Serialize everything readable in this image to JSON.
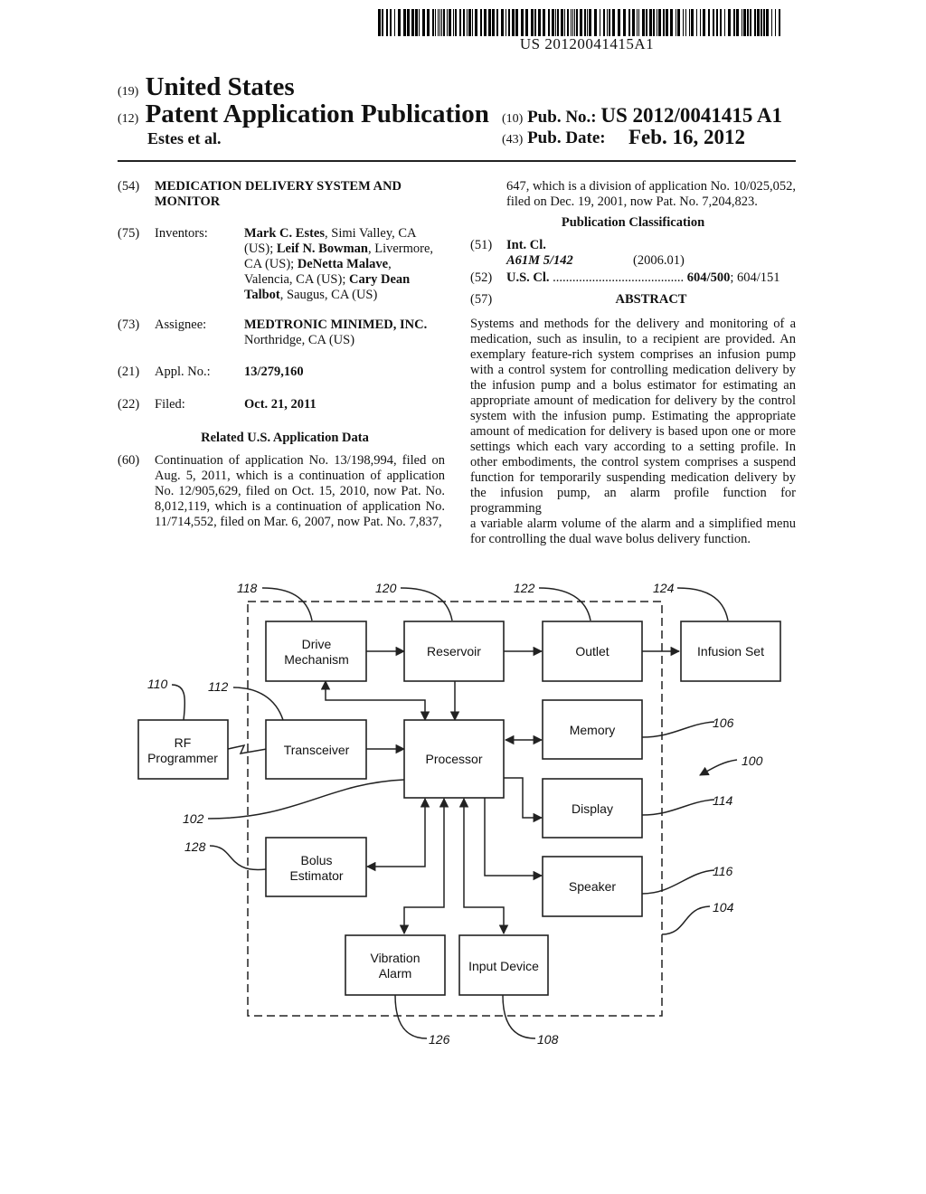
{
  "barcode": {
    "number": "US 20120041415A1"
  },
  "header": {
    "country_code": "(19)",
    "country": "United States",
    "type_code": "(12)",
    "type": "Patent Application Publication",
    "authors": "Estes et al.",
    "pub_no_code": "(10)",
    "pub_no_label": "Pub. No.:",
    "pub_no": "US 2012/0041415 A1",
    "pub_date_code": "(43)",
    "pub_date_label": "Pub. Date:",
    "pub_date": "Feb. 16, 2012"
  },
  "left": {
    "title": {
      "code": "(54)",
      "line1": "MEDICATION DELIVERY SYSTEM AND",
      "line2": "MONITOR"
    },
    "inventors": {
      "code": "(75)",
      "label": "Inventors:",
      "lines": [
        [
          {
            "t": "Mark C. Estes",
            "b": true
          },
          {
            "t": ", Simi Valley, CA",
            "b": false
          }
        ],
        [
          {
            "t": "(US); ",
            "b": false
          },
          {
            "t": "Leif N. Bowman",
            "b": true
          },
          {
            "t": ", Livermore,",
            "b": false
          }
        ],
        [
          {
            "t": "CA (US); ",
            "b": false
          },
          {
            "t": "DeNetta Malave",
            "b": true
          },
          {
            "t": ",",
            "b": false
          }
        ],
        [
          {
            "t": "Valencia, CA (US); ",
            "b": false
          },
          {
            "t": "Cary Dean",
            "b": true
          }
        ],
        [
          {
            "t": "Talbot",
            "b": true
          },
          {
            "t": ", Saugus, CA (US)",
            "b": false
          }
        ]
      ]
    },
    "assignee": {
      "code": "(73)",
      "label": "Assignee:",
      "name": "MEDTRONIC MINIMED, INC.",
      "location": "Northridge, CA (US)"
    },
    "appl": {
      "code": "(21)",
      "label": "Appl. No.:",
      "value": "13/279,160"
    },
    "filed": {
      "code": "(22)",
      "label": "Filed:",
      "value": "Oct. 21, 2011"
    },
    "related_heading": "Related U.S. Application Data",
    "related": {
      "code": "(60)",
      "lines": [
        "Continuation of application No. 13/198,994, filed on",
        "Aug. 5, 2011, which is a continuation of application",
        "No. 12/905,629, filed on Oct. 15, 2010, now Pat. No.",
        "8,012,119, which is a continuation of application No.",
        "11/714,552, filed on Mar. 6, 2007, now Pat. No. 7,837,"
      ]
    }
  },
  "right": {
    "related_cont": [
      "647, which is a division of application No. 10/025,052,",
      "filed on Dec. 19, 2001, now Pat. No. 7,204,823."
    ],
    "classification_heading": "Publication Classification",
    "int_cl": {
      "code": "(51)",
      "label": "Int. Cl.",
      "class": "A61M 5/142",
      "version": "(2006.01)"
    },
    "us_cl": {
      "code": "(52)",
      "label": "U.S. Cl.",
      "dots": "........................................",
      "primary": "604/500",
      "secondary": "; 604/151"
    },
    "abstract_code": "(57)",
    "abstract_heading": "ABSTRACT",
    "abstract_lines": [
      "Systems and methods for the delivery and monitoring of a",
      "medication, such as insulin, to a recipient are provided. An",
      "exemplary feature-rich system comprises an infusion pump",
      "with a control system for controlling medication delivery by",
      "the infusion pump and a bolus estimator for estimating an",
      "appropriate amount of medication for delivery by the control",
      "system with the infusion pump. Estimating the appropriate",
      "amount of medication for delivery is based upon one or more",
      "settings which each vary according to a setting profile. In",
      "other embodiments, the control system comprises a suspend",
      "function for temporarily suspending medication delivery by",
      "the infusion pump, an alarm profile function for programming",
      "a variable alarm volume of the alarm and a simplified menu",
      "for controlling the dual wave bolus delivery function."
    ]
  },
  "diagram": {
    "blocks": {
      "drive": [
        "Drive",
        "Mechanism"
      ],
      "reservoir": [
        "Reservoir"
      ],
      "outlet": [
        "Outlet"
      ],
      "infusion_set": [
        "Infusion Set"
      ],
      "rf_programmer": [
        "RF",
        "Programmer"
      ],
      "transceiver": [
        "Transceiver"
      ],
      "processor": [
        "Processor"
      ],
      "memory": [
        "Memory"
      ],
      "display": [
        "Display"
      ],
      "bolus": [
        "Bolus",
        "Estimator"
      ],
      "speaker": [
        "Speaker"
      ],
      "vibration": [
        "Vibration",
        "Alarm"
      ],
      "input": [
        "Input Device"
      ]
    },
    "refs": {
      "r118": "118",
      "r120": "120",
      "r122": "122",
      "r124": "124",
      "r110": "110",
      "r112": "112",
      "r106": "106",
      "r100": "100",
      "r102": "102",
      "r114": "114",
      "r128": "128",
      "r116": "116",
      "r104": "104",
      "r126": "126",
      "r108": "108"
    }
  }
}
